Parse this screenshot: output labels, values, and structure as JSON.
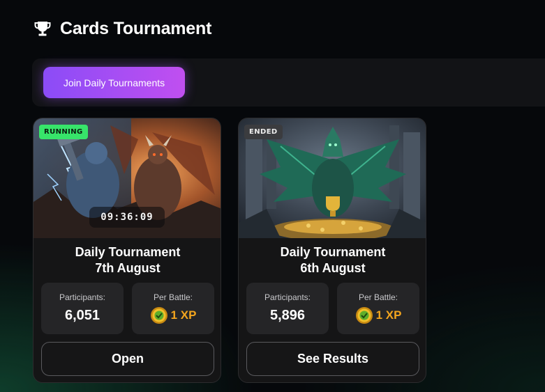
{
  "page": {
    "title": "Cards Tournament",
    "title_icon": "trophy-icon"
  },
  "toolbar": {
    "join_label": "Join Daily Tournaments"
  },
  "colors": {
    "accent": "#8b4cf7",
    "running": "#37e46a",
    "xp": "#f3a51e"
  },
  "cards": [
    {
      "status": "RUNNING",
      "timer": "09:36:09",
      "title_line1": "Daily Tournament",
      "title_line2": "7th August",
      "participants_label": "Participants:",
      "participants": "6,051",
      "per_battle_label": "Per Battle:",
      "per_battle": "1 XP",
      "button": "Open"
    },
    {
      "status": "ENDED",
      "title_line1": "Daily Tournament",
      "title_line2": "6th August",
      "participants_label": "Participants:",
      "participants": "5,896",
      "per_battle_label": "Per Battle:",
      "per_battle": "1 XP",
      "button": "See Results"
    }
  ]
}
